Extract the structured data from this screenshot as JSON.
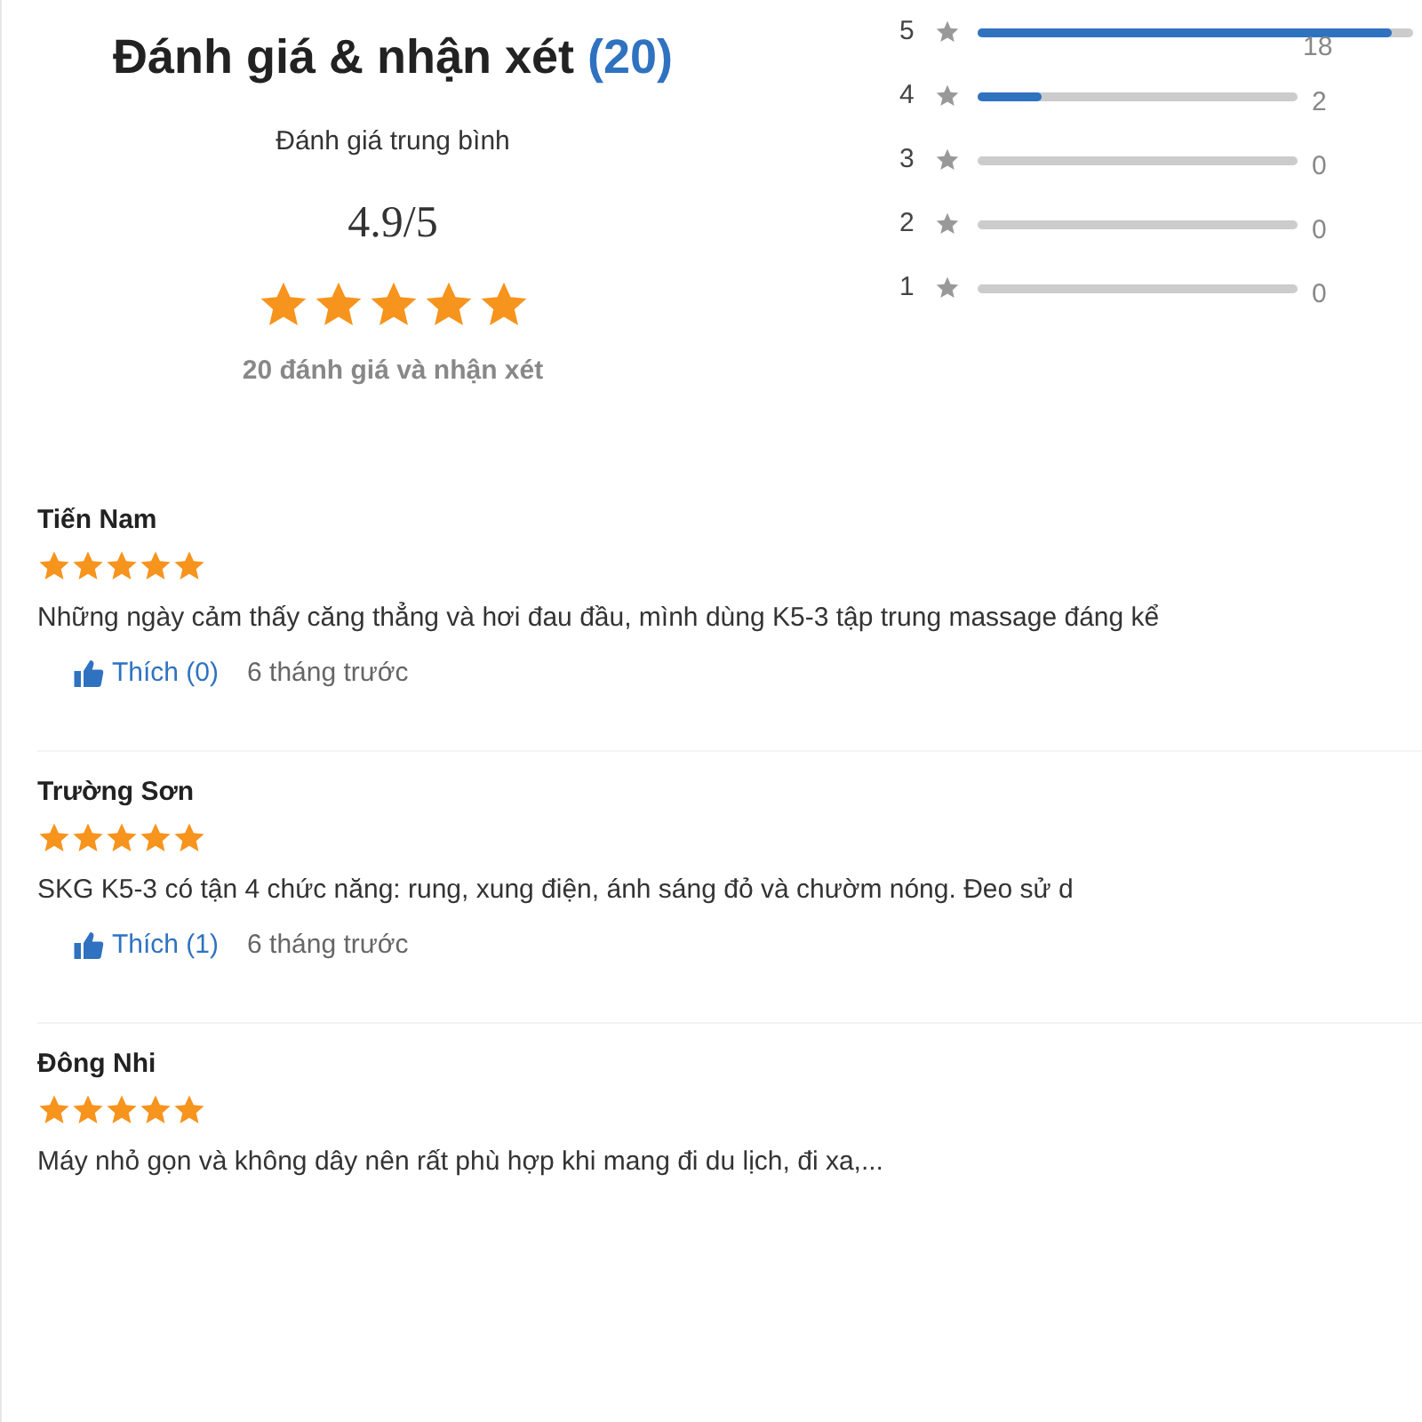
{
  "summary": {
    "title": "Đánh giá & nhận xét",
    "count": "(20)",
    "average_label": "Đánh giá trung bình",
    "average": "4.9/5",
    "stars": 5,
    "total": "20 đánh giá và nhận xét"
  },
  "distribution": [
    {
      "label": "5",
      "level": 0.95,
      "count": "18"
    },
    {
      "label": "4",
      "level": 0.2,
      "count": "2"
    },
    {
      "label": "3",
      "count": "0"
    },
    {
      "label": "2",
      "count": "0"
    },
    {
      "label": "1",
      "count": "0"
    }
  ],
  "reviews": [
    {
      "name": "Tiến Nam",
      "stars": 5,
      "text": "Những ngày cảm thấy căng thẳng và hơi đau đầu, mình dùng K5-3 tập trung massage đáng kể",
      "like": "Thích (0)",
      "time": "6 tháng trước"
    },
    {
      "name": "Trường Sơn",
      "stars": 5,
      "text": "SKG K5-3 có tận 4 chức năng: rung, xung điện, ánh sáng đỏ và chườm nóng. Đeo sử d",
      "like": "Thích (1)",
      "time": "6 tháng trước"
    },
    {
      "name": "Đông Nhi",
      "stars": 5,
      "text": "Máy nhỏ gọn và không dây nên rất phù hợp khi mang đi du lịch, đi xa,..."
    }
  ]
}
